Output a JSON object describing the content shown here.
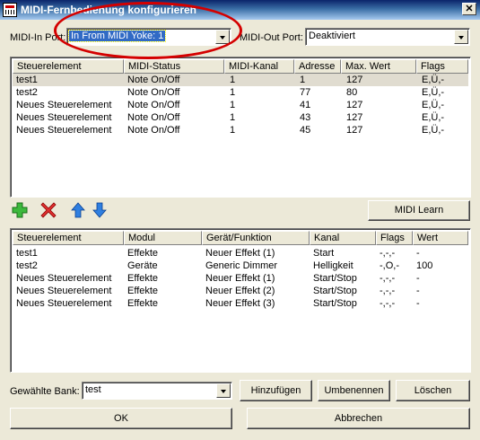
{
  "window": {
    "title": "MIDI-Fernbedienung konfigurieren",
    "close_glyph": "✕"
  },
  "midi_in": {
    "label": "MIDI-In Port:",
    "value": "In From MIDI Yoke:  1"
  },
  "midi_out": {
    "label": "MIDI-Out Port:",
    "value": "Deaktiviert"
  },
  "top_table": {
    "columns": [
      "Steuerelement",
      "MIDI-Status",
      "MIDI-Kanal",
      "Adresse",
      "Max. Wert",
      "Flags"
    ],
    "rows": [
      [
        "test1",
        "Note On/Off",
        "1",
        "1",
        "127",
        "E,Ü,-"
      ],
      [
        "test2",
        "Note On/Off",
        "1",
        "77",
        "80",
        "E,Ü,-"
      ],
      [
        "Neues Steuerelement",
        "Note On/Off",
        "1",
        "41",
        "127",
        "E,Ü,-"
      ],
      [
        "Neues Steuerelement",
        "Note On/Off",
        "1",
        "43",
        "127",
        "E,Ü,-"
      ],
      [
        "Neues Steuerelement",
        "Note On/Off",
        "1",
        "45",
        "127",
        "E,Ü,-"
      ]
    ]
  },
  "toolbar": {
    "midi_learn": "MIDI Learn",
    "icons": [
      "add-icon",
      "delete-icon",
      "arrow-up-icon",
      "arrow-down-icon"
    ]
  },
  "bottom_table": {
    "columns": [
      "Steuerelement",
      "Modul",
      "Gerät/Funktion",
      "Kanal",
      "Flags",
      "Wert"
    ],
    "rows": [
      [
        "test1",
        "Effekte",
        "Neuer Effekt (1)",
        "Start",
        "-,-,-",
        "-"
      ],
      [
        "test2",
        "Geräte",
        "Generic Dimmer",
        "Helligkeit",
        "-,O,-",
        "100"
      ],
      [
        "Neues Steuerelement",
        "Effekte",
        "Neuer Effekt (1)",
        "Start/Stop",
        "-,-,-",
        "-"
      ],
      [
        "Neues Steuerelement",
        "Effekte",
        "Neuer Effekt (2)",
        "Start/Stop",
        "-,-,-",
        "-"
      ],
      [
        "Neues Steuerelement",
        "Effekte",
        "Neuer Effekt (3)",
        "Start/Stop",
        "-,-,-",
        "-"
      ]
    ]
  },
  "bank": {
    "label": "Gewählte Bank:",
    "value": "test",
    "add": "Hinzufügen",
    "rename": "Umbenennen",
    "delete": "Löschen"
  },
  "footer": {
    "ok": "OK",
    "cancel": "Abbrechen"
  },
  "colors": {
    "titlebar": "#0a246a",
    "face": "#ece9d8",
    "highlight": "#316ac5",
    "annotation_ring": "#d40000"
  }
}
